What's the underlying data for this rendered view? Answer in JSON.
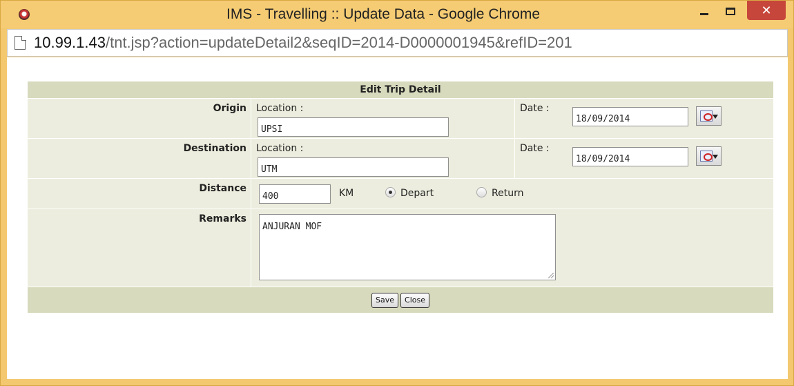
{
  "window": {
    "title": "IMS - Travelling :: Update Data - Google Chrome",
    "controls": {
      "minimize_icon": "minimize-icon",
      "maximize_icon": "maximize-icon",
      "close_label": "✕"
    }
  },
  "address_bar": {
    "host": "10.99.1.43",
    "path": "/tnt.jsp?action=updateDetail2&seqID=2014-D0000001945&refID=201"
  },
  "form": {
    "title": "Edit Trip Detail",
    "origin": {
      "label": "Origin",
      "location_label": "Location :",
      "location_value": "UPSI",
      "date_label": "Date :",
      "date_value": "18/09/2014"
    },
    "destination": {
      "label": "Destination",
      "location_label": "Location :",
      "location_value": "UTM",
      "date_label": "Date :",
      "date_value": "18/09/2014"
    },
    "distance": {
      "label": "Distance",
      "value": "400",
      "unit": "KM",
      "options": [
        {
          "label": "Depart",
          "checked": true
        },
        {
          "label": "Return",
          "checked": false
        }
      ]
    },
    "remarks": {
      "label": "Remarks",
      "value": "ANJURAN MOF"
    },
    "buttons": {
      "save": "Save",
      "close": "Close"
    }
  }
}
